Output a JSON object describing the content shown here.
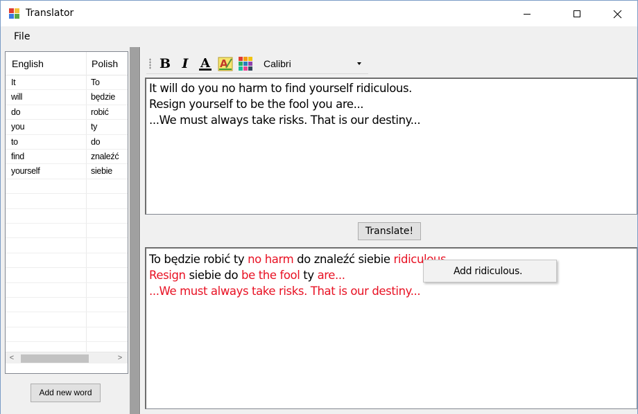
{
  "window": {
    "title": "Translator"
  },
  "menu": {
    "file": "File"
  },
  "dictionary": {
    "headers": [
      "English",
      "Polish"
    ],
    "rows": [
      [
        "It",
        "To"
      ],
      [
        "will",
        "będzie"
      ],
      [
        "do",
        "robić"
      ],
      [
        "you",
        "ty"
      ],
      [
        "to",
        "do"
      ],
      [
        "find",
        "znaleźć"
      ],
      [
        "yourself",
        "siebie"
      ]
    ],
    "scroll_left": "<",
    "scroll_right": ">",
    "add_button": "Add new word"
  },
  "toolbar": {
    "bold_label": "B",
    "italic_label": "I",
    "font_name": "Calibri"
  },
  "source_text": {
    "lines": [
      "It will do you no harm to find yourself ridiculous.",
      "Resign yourself to be the fool you are...",
      "...We must always take risks. That is our destiny..."
    ]
  },
  "translate_button": "Translate!",
  "output_text": {
    "line1": [
      {
        "text": "To będzie robić ty ",
        "untranslated": false
      },
      {
        "text": "no harm",
        "untranslated": true
      },
      {
        "text": " do znaleźć siebie ",
        "untranslated": false
      },
      {
        "text": "ridiculous.",
        "untranslated": true
      }
    ],
    "line2": [
      {
        "text": "Resign",
        "untranslated": true
      },
      {
        "text": " siebie do ",
        "untranslated": false
      },
      {
        "text": "be the fool",
        "untranslated": true
      },
      {
        "text": " ty ",
        "untranslated": false
      },
      {
        "text": "are...",
        "untranslated": true
      }
    ],
    "line3": [
      {
        "text": "...We must always take risks. That is our destiny...",
        "untranslated": true
      }
    ]
  },
  "context_menu": {
    "item": "Add ridiculous."
  },
  "colors": {
    "untranslated": "#e81123",
    "title_border": "#7a9cc6"
  }
}
